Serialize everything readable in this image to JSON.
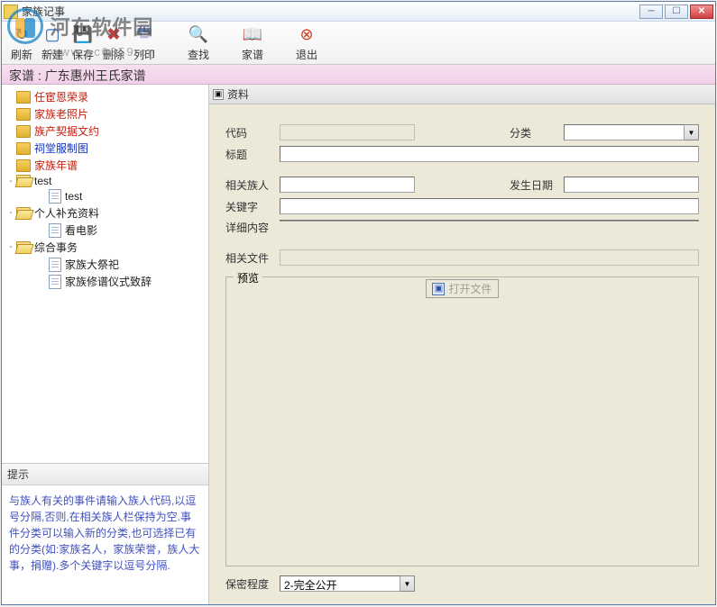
{
  "watermark": {
    "text": "河东软件园",
    "url": "www.pc0359.cn"
  },
  "window": {
    "title": "家族记事"
  },
  "toolbar": {
    "refresh": "刷新",
    "new": "新建",
    "save": "保存",
    "delete": "删除",
    "print": "列印",
    "find": "查找",
    "genealogy": "家谱",
    "exit": "退出"
  },
  "context": {
    "label": "家谱 : 广东惠州王氏家谱"
  },
  "tree": {
    "items": [
      {
        "label": "任宦恩荣录",
        "type": "folder-closed",
        "color": "red",
        "indent": 0
      },
      {
        "label": "家族老照片",
        "type": "folder-closed",
        "color": "red",
        "indent": 0
      },
      {
        "label": "族产契据文约",
        "type": "folder-closed",
        "color": "red",
        "indent": 0
      },
      {
        "label": "祠堂服制图",
        "type": "folder-closed",
        "color": "blue",
        "indent": 0
      },
      {
        "label": "家族年谱",
        "type": "folder-closed",
        "color": "red",
        "indent": 0
      },
      {
        "label": "test",
        "type": "folder-open",
        "color": "black",
        "indent": 0,
        "expander": "-"
      },
      {
        "label": "test",
        "type": "doc",
        "color": "black",
        "indent": 2
      },
      {
        "label": "个人补充资料",
        "type": "folder-open",
        "color": "black",
        "indent": 0,
        "expander": "-"
      },
      {
        "label": "看电影",
        "type": "doc",
        "color": "black",
        "indent": 2
      },
      {
        "label": "综合事务",
        "type": "folder-open",
        "color": "black",
        "indent": 0,
        "expander": "-"
      },
      {
        "label": "家族大祭祀",
        "type": "doc",
        "color": "black",
        "indent": 2
      },
      {
        "label": "家族修谱仪式致辞",
        "type": "doc",
        "color": "black",
        "indent": 2
      }
    ]
  },
  "hint": {
    "header": "提示",
    "body": "与族人有关的事件请输入族人代码,以逗号分隔,否则,在相关族人栏保持为空.事件分类可以输入新的分类,也可选择已有的分类(如:家族名人，家族荣誉，族人大事，捐赠).多个关键字以逗号分隔."
  },
  "section": {
    "collapse": "▣",
    "header": "资料"
  },
  "form": {
    "code_label": "代码",
    "category_label": "分类",
    "title_label": "标题",
    "related_label": "相关族人",
    "date_label": "发生日期",
    "keyword_label": "关键字",
    "detail_label": "详细内容",
    "file_label": "相关文件",
    "preview_label": "预览",
    "openfile_label": "打开文件",
    "secrecy_label": "保密程度",
    "secrecy_value": "2-完全公开"
  }
}
